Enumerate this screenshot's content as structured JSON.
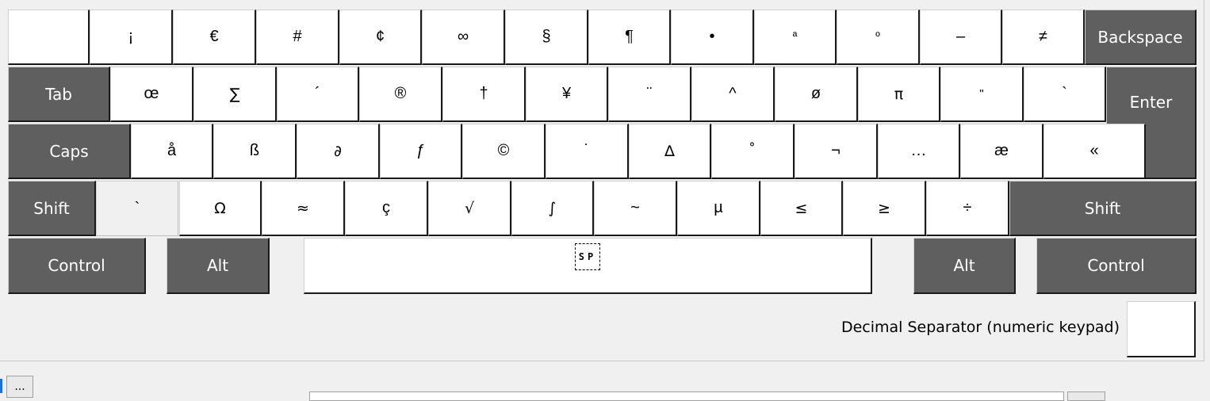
{
  "keyboard": {
    "row1": [
      {
        "label": ""
      },
      {
        "label": "¡"
      },
      {
        "label": "€"
      },
      {
        "label": "#"
      },
      {
        "label": "¢"
      },
      {
        "label": "∞"
      },
      {
        "label": "§"
      },
      {
        "label": "¶"
      },
      {
        "label": "•"
      },
      {
        "label": "ª"
      },
      {
        "label": "º"
      },
      {
        "label": "–"
      },
      {
        "label": "≠"
      }
    ],
    "row2": [
      {
        "label": "œ"
      },
      {
        "label": "∑"
      },
      {
        "label": "´"
      },
      {
        "label": "®"
      },
      {
        "label": "†"
      },
      {
        "label": "¥"
      },
      {
        "label": "¨"
      },
      {
        "label": "^"
      },
      {
        "label": "ø"
      },
      {
        "label": "π"
      },
      {
        "label": "\""
      },
      {
        "label": "`"
      }
    ],
    "row3": [
      {
        "label": "å"
      },
      {
        "label": "ß"
      },
      {
        "label": "∂"
      },
      {
        "label": "ƒ"
      },
      {
        "label": "©"
      },
      {
        "label": "˙"
      },
      {
        "label": "∆"
      },
      {
        "label": "˚"
      },
      {
        "label": "¬"
      },
      {
        "label": "…"
      },
      {
        "label": "æ"
      },
      {
        "label": "«"
      }
    ],
    "row4": [
      {
        "label": "`"
      },
      {
        "label": "Ω"
      },
      {
        "label": "≈"
      },
      {
        "label": "ç"
      },
      {
        "label": "√"
      },
      {
        "label": "∫"
      },
      {
        "label": "~"
      },
      {
        "label": "µ"
      },
      {
        "label": "≤"
      },
      {
        "label": "≥"
      },
      {
        "label": "÷"
      }
    ],
    "modifiers": {
      "backspace": "Backspace",
      "tab": "Tab",
      "enter": "Enter",
      "caps": "Caps",
      "shift_left": "Shift",
      "shift_right": "Shift",
      "control_left": "Control",
      "alt_left": "Alt",
      "space": "SP",
      "alt_right": "Alt",
      "control_right": "Control"
    },
    "decimal_separator_label": "Decimal Separator (numeric keypad)",
    "decimal_separator_value": ""
  },
  "footer": {
    "ellipsis_button": "..."
  },
  "colors": {
    "modifier_key": "#5f5f5f",
    "key": "#ffffff",
    "background": "#f0f0f0"
  }
}
